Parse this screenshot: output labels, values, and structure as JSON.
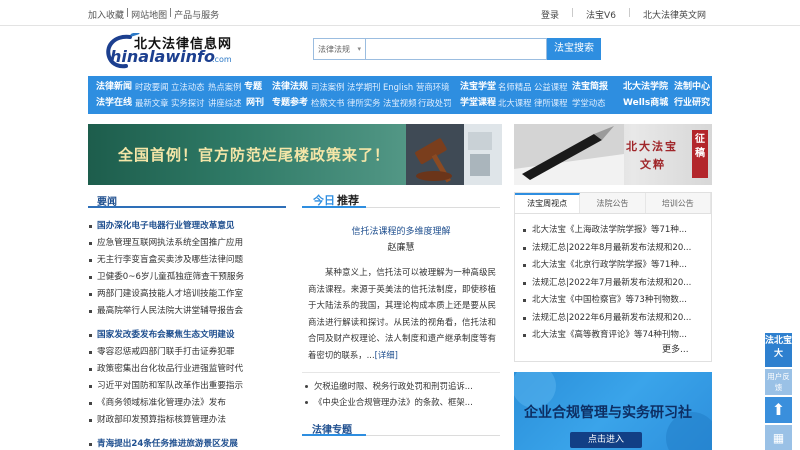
{
  "topbar": {
    "left": [
      "加入收藏",
      "网站地图",
      "产品与服务"
    ],
    "right": [
      "登录",
      "法宝V6",
      "北大法律英文网"
    ]
  },
  "logo": {
    "cn": "北大法律信息网",
    "en": "hinalawinfo",
    "domain": ".com"
  },
  "search": {
    "scope": "法律法规",
    "query": "",
    "button": "法宝搜索"
  },
  "nav": {
    "row1": [
      {
        "t": "法律新闻",
        "b": true
      },
      {
        "t": "时政要闻"
      },
      {
        "t": "立法动态"
      },
      {
        "t": "热点案例"
      },
      {
        "t": "专题",
        "b": true
      },
      {
        "t": "法律法规",
        "b": true
      },
      {
        "t": "司法案例"
      },
      {
        "t": "法学期刊"
      },
      {
        "t": "English"
      },
      {
        "t": "营商环境"
      },
      {
        "t": "法宝学堂",
        "b": true
      },
      {
        "t": "名师精品"
      },
      {
        "t": "公益课程"
      },
      {
        "t": "法宝简报",
        "b": true
      },
      {
        "t": "北大法学院",
        "b": true
      },
      {
        "t": "法制中心",
        "b": true
      }
    ],
    "row2": [
      {
        "t": "法学在线",
        "b": true
      },
      {
        "t": "最新文章"
      },
      {
        "t": "实务探讨"
      },
      {
        "t": "讲座综述"
      },
      {
        "t": "网刊",
        "b": true
      },
      {
        "t": "专题参考",
        "b": true
      },
      {
        "t": "检察文书"
      },
      {
        "t": "律所实务"
      },
      {
        "t": "法宝视频"
      },
      {
        "t": "行政处罚"
      },
      {
        "t": "学堂课程",
        "b": true
      },
      {
        "t": "北大课程"
      },
      {
        "t": "律所课程"
      },
      {
        "t": "学堂动态"
      },
      {
        "t": "Wells商城",
        "b": true
      },
      {
        "t": "行业研究",
        "b": true
      }
    ]
  },
  "banner1": {
    "text": "全国首例！官方防范烂尾楼政策来了！"
  },
  "banner2": {
    "line1": "北大法宝",
    "line2": "文粹",
    "seal": "征稿"
  },
  "yaowen": {
    "title": "要闻",
    "group1": [
      "国办深化电子电器行业管理改革意见",
      "应急管理互联网执法系统全国推广应用",
      "无主行李变盲盒买卖涉及哪些法律问题",
      "卫健委0~6岁儿童孤独症筛查干预服务",
      "两部门建设高技能人才培训技能工作室",
      "最高院举行人民法院大讲堂辅导报告会"
    ],
    "group2": [
      "国家发改委发布会聚焦生态文明建设",
      "零容忍惩戒四部门联手打击证券犯罪",
      "政策密集出台化妆品行业进强监管时代",
      "习近平对国防和军队改革作出重要指示",
      "《商务领域标准化管理办法》发布",
      "财政部印发预算指标核算管理办法"
    ],
    "group3": [
      "青海提出24条任务推进旅游景区发展"
    ]
  },
  "center": {
    "head_a": "今日",
    "head_b": "推荐",
    "article_title": "信托法课程的多维度理解",
    "article_author": "赵廉慧",
    "article_body": "某种意义上，信托法可以被理解为一种高级民商法课程。来源于英美法的信托法制度，即使移植于大陆法系的我国，其理论构成本质上还是要从民商法进行解读和探讨。从民法的视角看，信托法和合同及财产权理论、法人制度和遗产继承制度等有着密切的联系，...",
    "more": "[详细]",
    "list": [
      "欠税追缴时限、税务行政处罚和刑罚追诉...",
      "《中央企业合规管理办法》的条款、框架..."
    ],
    "topic_head": "法律专题"
  },
  "right": {
    "tabs": [
      "法宝周视点",
      "法院公告",
      "培训公告"
    ],
    "items": [
      "北大法宝《上海政法学院学报》等71种...",
      "法规汇总|2022年8月最新发布法规和20...",
      "北大法宝《北京行政学院学报》等71种...",
      "法规汇总|2022年7月最新发布法规和20...",
      "北大法宝《中国检察官》等73种刊物数...",
      "法规汇总|2022年6月最新发布法规和20...",
      "北大法宝《高等教育评论》等74种刊物..."
    ],
    "more": "更多..."
  },
  "banner3": {
    "text": "企业合规管理与实务研习社",
    "button": "点击进入"
  },
  "float": {
    "f1": "法北宝大",
    "f2": "用户反馈",
    "f3": "⬆",
    "f4": "▦"
  }
}
